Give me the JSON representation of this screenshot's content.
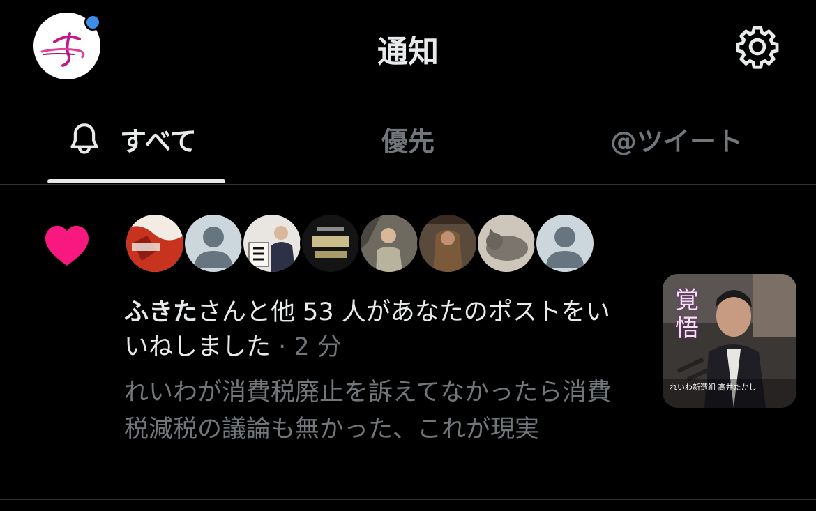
{
  "header": {
    "title": "通知",
    "has_unread_dot": true,
    "icons": [
      "profile-avatar",
      "gear-icon"
    ]
  },
  "tabs": [
    {
      "label": "すべて",
      "icon": "bell-icon",
      "selected": true
    },
    {
      "label": "優先",
      "selected": false
    },
    {
      "label": "@ツイート",
      "selected": false
    }
  ],
  "notification": {
    "type": "like",
    "icon": "heart-icon",
    "liker_name": "ふきた",
    "message_rest": "さんと他 53 人があなたのポストをいいねしました",
    "time_sep": " · ",
    "time": "2 分",
    "post_text": "れいわが消費税廃止を訴えてなかったら消費税減税の議論も無かった、これが現実",
    "avatar_count": 8,
    "thumbnail": {
      "caption_kanji": "覚悟",
      "caption_line": "れいわ新選組 高井たかし"
    }
  },
  "colors": {
    "background": "#000000",
    "text_primary": "#e7e9ea",
    "text_secondary": "#71767b",
    "like_pink": "#f91880",
    "unread_dot": "#3f8ee6"
  }
}
